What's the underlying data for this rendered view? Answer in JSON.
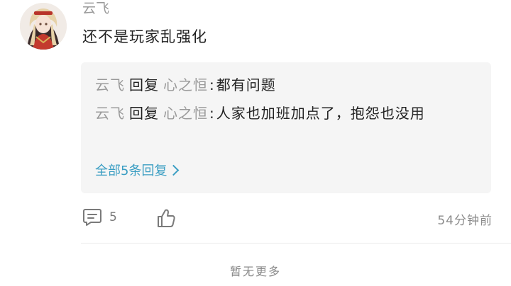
{
  "comment": {
    "username": "云飞",
    "text": "还不是玩家乱强化"
  },
  "replies": {
    "items": [
      {
        "author": "云飞",
        "reply_word": "回复",
        "target": "心之恒",
        "colon": ":",
        "text": "都有问题"
      },
      {
        "author": "云飞",
        "reply_word": "回复",
        "target": "心之恒",
        "colon": ":",
        "text": "人家也加班加点了，抱怨也没用"
      }
    ],
    "more_label": "全部5条回复"
  },
  "actions": {
    "comment_count": "5",
    "timestamp": "54分钟前"
  },
  "footer": {
    "no_more_label": "暂无更多"
  },
  "colors": {
    "link": "#3b9ec3",
    "muted": "#9a9a9a",
    "reply_bg": "#f5f5f5"
  },
  "icons": [
    "avatar",
    "comment-icon",
    "thumbs-up-icon",
    "chevron-right-icon"
  ]
}
